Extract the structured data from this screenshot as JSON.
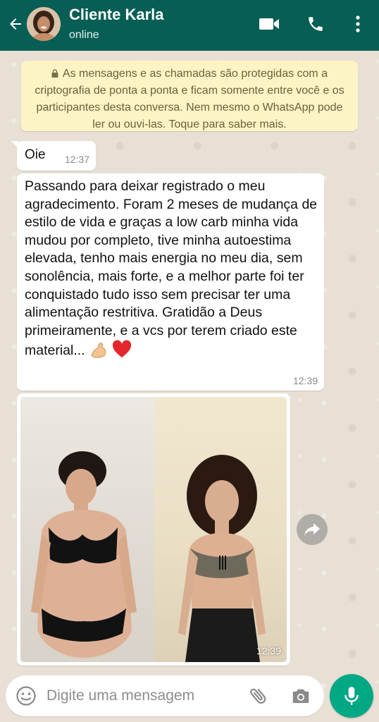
{
  "header": {
    "contact_name": "Cliente Karla",
    "status": "online"
  },
  "notice": {
    "text": "As mensagens e as chamadas são protegidas com a criptografia de ponta a ponta e ficam somente entre você e os participantes desta conversa. Nem mesmo o WhatsApp pode ler ou ouvi-las. Toque para saber mais."
  },
  "messages": [
    {
      "text": "Oie",
      "time": "12:37"
    },
    {
      "text": "Passando para deixar registrado o meu agradecimento. Foram 2 meses de mudança de estilo de vida e graças a low carb minha vida mudou por completo, tive minha autoestima elevada, tenho mais energia no meu dia, sem sonolência, mais forte, e a melhor parte foi ter conquistado tudo isso sem precisar ter uma alimentação restritiva. Gratidão a Deus primeiramente, e a vcs por terem criado este material...",
      "time": "12:39",
      "emojis": [
        "flexed-biceps",
        "red-heart"
      ]
    },
    {
      "type": "image",
      "time": "12:39"
    }
  ],
  "input": {
    "placeholder": "Digite uma mensagem"
  },
  "colors": {
    "header": "#075e54",
    "notice_bg": "#fdf4c5",
    "mic": "#00a884"
  }
}
